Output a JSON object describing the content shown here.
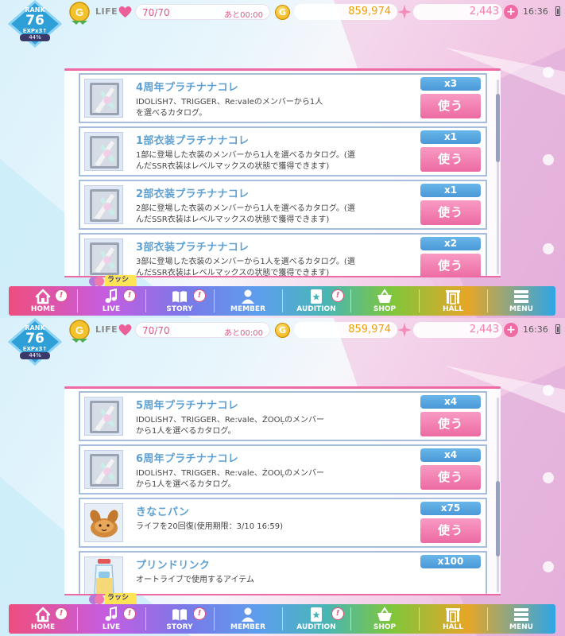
{
  "status_bar": {
    "rank_label": "RANK",
    "rank_value": "76",
    "exp_label": "EXPx3↑",
    "exp_percent": "44%",
    "medal_letter": "G",
    "life_label": "LIFE",
    "stamina": "70/70",
    "stamina_timer": "あと00:00",
    "coin_letter": "G",
    "gold": "859,974",
    "gems": "2,443",
    "plus": "+",
    "clock": "16:36"
  },
  "screen1": {
    "items": [
      {
        "name": "4周年プラチナナコレ",
        "desc": "IDOLiSH7、TRIGGER、Re:valeのメンバーから1人\nを選べるカタログ。",
        "qty": "x3",
        "use": "使う",
        "thumb": "catalog-book-icon"
      },
      {
        "name": "1部衣装プラチナナコレ",
        "desc": "1部に登場した衣装のメンバーから1人を選べるカタログ。(選\nんだSSR衣装はレベルマックスの状態で獲得できます)",
        "qty": "x1",
        "use": "使う",
        "thumb": "catalog-book-icon"
      },
      {
        "name": "2部衣装プラチナナコレ",
        "desc": "2部に登場した衣装のメンバーから1人を選べるカタログ。(選\nんだSSR衣装はレベルマックスの状態で獲得できます)",
        "qty": "x1",
        "use": "使う",
        "thumb": "catalog-book-icon"
      },
      {
        "name": "3部衣装プラチナナコレ",
        "desc": "3部に登場した衣装のメンバーから1人を選べるカタログ。(選\nんだSSR衣装はレベルマックスの状態で獲得できます)",
        "qty": "x2",
        "use": "使う",
        "thumb": "catalog-book-icon"
      }
    ]
  },
  "screen2": {
    "items": [
      {
        "name": "5周年プラチナナコレ",
        "desc": "IDOLiSH7、TRIGGER、Re:vale、ŹOOĻのメンバー\nから1人を選べるカタログ。",
        "qty": "x4",
        "use": "使う",
        "thumb": "catalog-book-icon"
      },
      {
        "name": "6周年プラチナナコレ",
        "desc": "IDOLiSH7、TRIGGER、Re:vale、ŹOOĻのメンバー\nから1人を選べるカタログ。",
        "qty": "x4",
        "use": "使う",
        "thumb": "catalog-book-icon"
      },
      {
        "name": "きなこパン",
        "desc": "ライフを20回復(使用期限：3/10 16:59)",
        "qty": "x75",
        "use": "使う",
        "thumb": "kinako-bread-icon"
      },
      {
        "name": "プリンドリンク",
        "desc": "オートライブで使用するアイテム",
        "qty": "x100",
        "use": "使う",
        "thumb": "pudding-drink-icon"
      }
    ]
  },
  "nav": {
    "rush_label": "ラッシュ",
    "badge": "!",
    "items": [
      {
        "label": "HOME",
        "icon": "house-icon",
        "badge": true
      },
      {
        "label": "LIVE",
        "icon": "music-note-icon",
        "badge": true
      },
      {
        "label": "STORY",
        "icon": "open-book-icon",
        "badge": true
      },
      {
        "label": "MEMBER",
        "icon": "person-icon",
        "badge": false
      },
      {
        "label": "AUDITION",
        "icon": "card-icon",
        "badge": true
      },
      {
        "label": "SHOP",
        "icon": "basket-icon",
        "badge": false
      },
      {
        "label": "HALL",
        "icon": "gate-icon",
        "badge": false
      },
      {
        "label": "MENU",
        "icon": "menu-icon",
        "badge": false
      }
    ]
  }
}
